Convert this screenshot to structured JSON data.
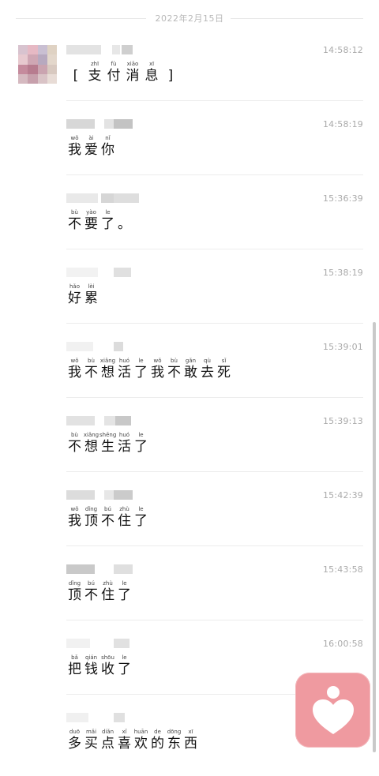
{
  "date_separator": "2022年2月15日",
  "messages": [
    {
      "time": "14:58:12",
      "chars": [
        {
          "py": "",
          "hz": "["
        },
        {
          "py": "zhī",
          "hz": "支"
        },
        {
          "py": "fù",
          "hz": "付"
        },
        {
          "py": "xiāo",
          "hz": "消"
        },
        {
          "py": "xī",
          "hz": "息"
        },
        {
          "py": "",
          "hz": "]"
        }
      ]
    },
    {
      "time": "14:58:19",
      "chars": [
        {
          "py": "wǒ",
          "hz": "我"
        },
        {
          "py": "ài",
          "hz": "爱"
        },
        {
          "py": "nǐ",
          "hz": "你"
        }
      ]
    },
    {
      "time": "15:36:39",
      "chars": [
        {
          "py": "bù",
          "hz": "不"
        },
        {
          "py": "yào",
          "hz": "要"
        },
        {
          "py": "le",
          "hz": "了"
        },
        {
          "py": "",
          "hz": "。"
        }
      ]
    },
    {
      "time": "15:38:19",
      "chars": [
        {
          "py": "hǎo",
          "hz": "好"
        },
        {
          "py": "lèi",
          "hz": "累"
        }
      ]
    },
    {
      "time": "15:39:01",
      "chars": [
        {
          "py": "wǒ",
          "hz": "我"
        },
        {
          "py": "bù",
          "hz": "不"
        },
        {
          "py": "xiǎng",
          "hz": "想"
        },
        {
          "py": "huó",
          "hz": "活"
        },
        {
          "py": "le",
          "hz": "了"
        },
        {
          "py": "wǒ",
          "hz": "我"
        },
        {
          "py": "bù",
          "hz": "不"
        },
        {
          "py": "gǎn",
          "hz": "敢"
        },
        {
          "py": "qù",
          "hz": "去"
        },
        {
          "py": "sǐ",
          "hz": "死"
        }
      ]
    },
    {
      "time": "15:39:13",
      "chars": [
        {
          "py": "bù",
          "hz": "不"
        },
        {
          "py": "xiǎng",
          "hz": "想"
        },
        {
          "py": "shēng",
          "hz": "生"
        },
        {
          "py": "huó",
          "hz": "活"
        },
        {
          "py": "le",
          "hz": "了"
        }
      ]
    },
    {
      "time": "15:42:39",
      "chars": [
        {
          "py": "wǒ",
          "hz": "我"
        },
        {
          "py": "dǐng",
          "hz": "顶"
        },
        {
          "py": "bú",
          "hz": "不"
        },
        {
          "py": "zhù",
          "hz": "住"
        },
        {
          "py": "le",
          "hz": "了"
        }
      ]
    },
    {
      "time": "15:43:58",
      "chars": [
        {
          "py": "dǐng",
          "hz": "顶"
        },
        {
          "py": "bú",
          "hz": "不"
        },
        {
          "py": "zhù",
          "hz": "住"
        },
        {
          "py": "le",
          "hz": "了"
        }
      ]
    },
    {
      "time": "16:00:58",
      "chars": [
        {
          "py": "bǎ",
          "hz": "把"
        },
        {
          "py": "qián",
          "hz": "钱"
        },
        {
          "py": "shōu",
          "hz": "收"
        },
        {
          "py": "le",
          "hz": "了"
        }
      ]
    },
    {
      "time": "",
      "chars": [
        {
          "py": "duō",
          "hz": "多"
        },
        {
          "py": "mǎi",
          "hz": "买"
        },
        {
          "py": "diǎn",
          "hz": "点"
        },
        {
          "py": "xǐ",
          "hz": "喜"
        },
        {
          "py": "huān",
          "hz": "欢"
        },
        {
          "py": "de",
          "hz": "的"
        },
        {
          "py": "dōng",
          "hz": "东"
        },
        {
          "py": "xī",
          "hz": "西"
        }
      ]
    }
  ],
  "colors": {
    "accent": "#ef9aa0",
    "divider": "#ececec",
    "time": "#aaaaaa"
  },
  "icons": {
    "app_icon": "heart-person-icon"
  }
}
